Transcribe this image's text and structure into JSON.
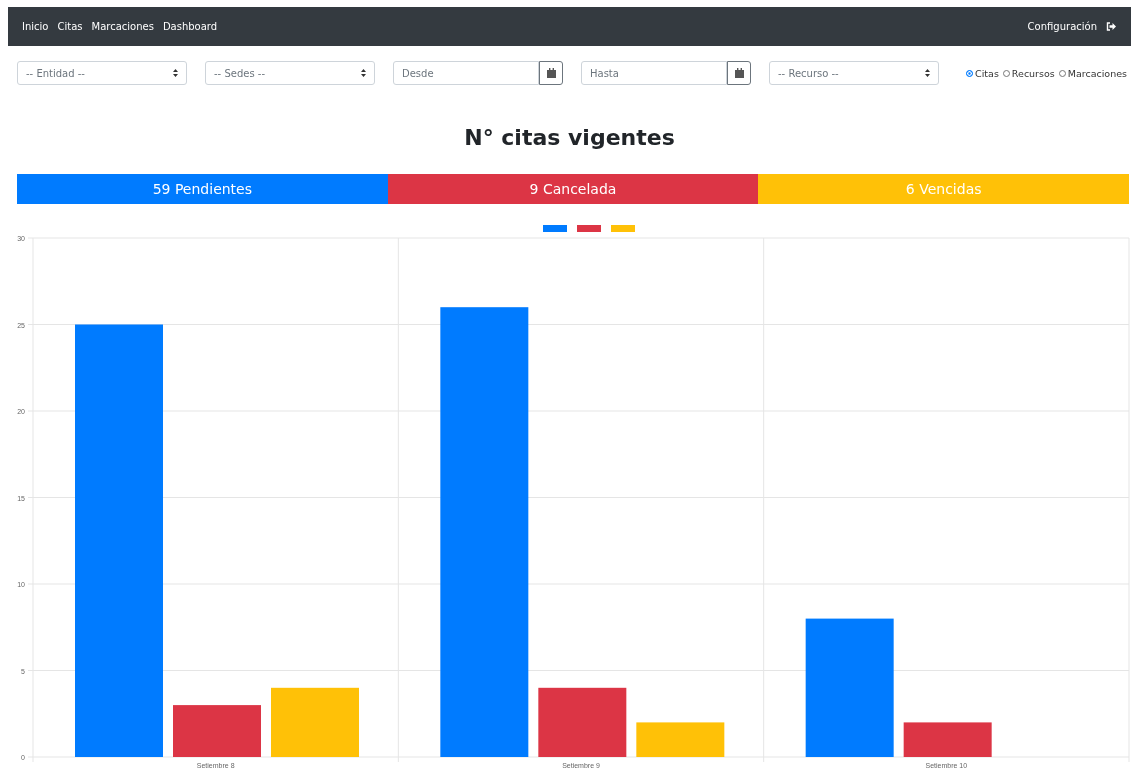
{
  "navbar": {
    "links": [
      "Inicio",
      "Citas",
      "Marcaciones",
      "Dashboard"
    ],
    "settings_link": "Configuración"
  },
  "filters": [
    {
      "kind": "select",
      "value": "-- Entidad --"
    },
    {
      "kind": "select",
      "value": "-- Sedes --"
    },
    {
      "kind": "date",
      "placeholder": "Desde"
    },
    {
      "kind": "date",
      "placeholder": "Hasta"
    },
    {
      "kind": "select",
      "value": "-- Recurso --"
    }
  ],
  "view_options": [
    {
      "label": "Citas",
      "selected": true
    },
    {
      "label": "Recursos",
      "selected": false
    },
    {
      "label": "Marcaciones",
      "selected": false
    }
  ],
  "title": "N° citas vigentes",
  "summary": [
    {
      "text": "59 Pendientes",
      "color": "#007bff"
    },
    {
      "text": "9 Cancelada",
      "color": "#dc3545"
    },
    {
      "text": "6 Vencidas",
      "color": "#ffc107"
    }
  ],
  "chart_data": {
    "type": "bar",
    "categories": [
      "Setiembre 8",
      "Setiembre 9",
      "Setiembre 10"
    ],
    "series": [
      {
        "color": "#007bff",
        "values": [
          25,
          26,
          8
        ]
      },
      {
        "color": "#dc3545",
        "values": [
          3,
          4,
          2
        ]
      },
      {
        "color": "#ffc107",
        "values": [
          4,
          2,
          null
        ]
      }
    ],
    "grid": true,
    "ylim": [
      0,
      30
    ],
    "yticks": [
      0,
      5,
      10,
      15,
      20,
      25,
      30
    ]
  }
}
